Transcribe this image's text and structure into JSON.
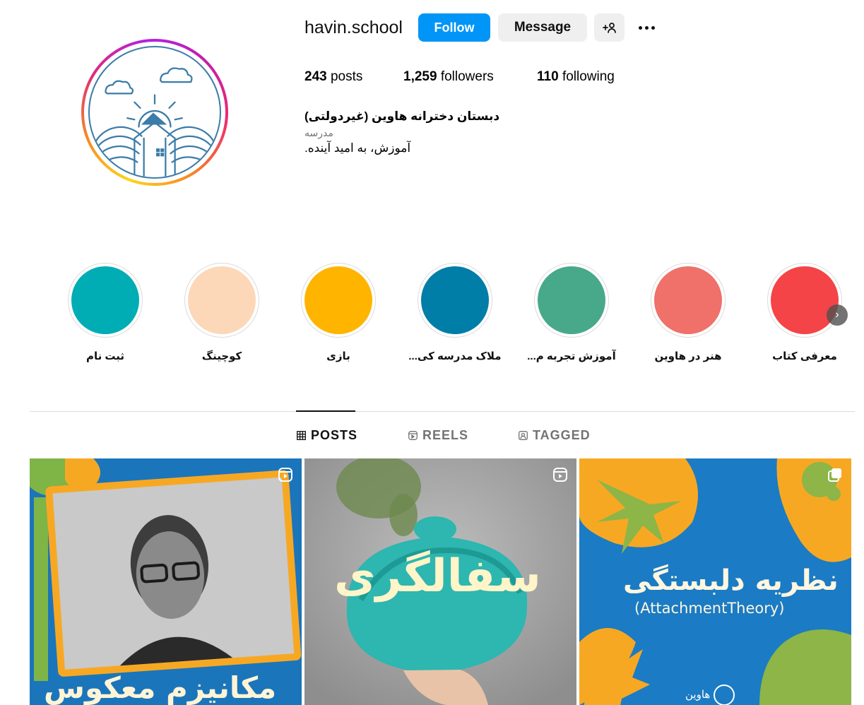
{
  "profile": {
    "username": "havin.school",
    "follow_label": "Follow",
    "message_label": "Message",
    "add_user_glyph": "+👤",
    "stats": {
      "posts_count": "243",
      "posts_label": "posts",
      "followers_count": "1,259",
      "followers_label": "followers",
      "following_count": "110",
      "following_label": "following"
    },
    "bio": {
      "name": "دبستان دخترانه هاوین (غیردولتی)",
      "category": "مدرسه",
      "text": "آموزش، به امید آینده."
    }
  },
  "highlights": [
    {
      "label": "ثبت نام",
      "color": "#00adb5"
    },
    {
      "label": "کوچینگ",
      "color": "#fcd8b8"
    },
    {
      "label": "بازی",
      "color": "#ffb400"
    },
    {
      "label": "ملاک مدرسه کی...",
      "color": "#007ea7"
    },
    {
      "label": "آموزش تجربه م...",
      "color": "#47a98a"
    },
    {
      "label": "هنر در هاوین",
      "color": "#f0706a"
    },
    {
      "label": "معرفی کتاب",
      "color": "#f44447"
    }
  ],
  "tabs": [
    {
      "label": "POSTS",
      "icon": "grid-icon",
      "active": true
    },
    {
      "label": "REELS",
      "icon": "reels-icon",
      "active": false
    },
    {
      "label": "TAGGED",
      "icon": "tagged-icon",
      "active": false
    }
  ],
  "posts": [
    {
      "type": "reel",
      "caption": "مکانیزم معکوس",
      "colors": {
        "bg": "#1b75bb",
        "accent": "#f7a823",
        "green": "#7fb446"
      }
    },
    {
      "type": "reel",
      "caption": "سفالگری",
      "colors": {
        "bg": "#9a9a9a",
        "clay": "#2eb6b0"
      }
    },
    {
      "type": "carousel",
      "caption": "نظریه دلبستگی",
      "subcaption": "(AttachmentTheory)",
      "logo_text": "هاوین",
      "colors": {
        "bg": "#1b7bc4",
        "accent": "#f7a823",
        "green": "#8db547"
      }
    }
  ],
  "colors": {
    "follow_blue": "#0095f6",
    "button_gray": "#efefef",
    "muted_text": "#737373"
  }
}
